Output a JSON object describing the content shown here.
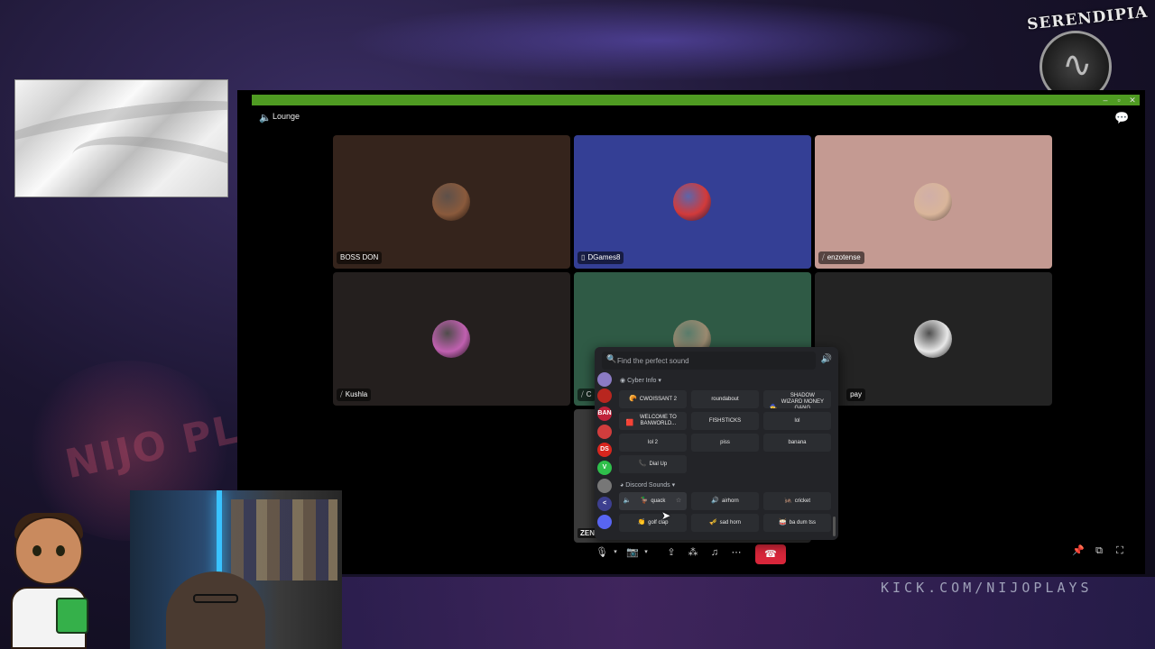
{
  "channel": {
    "name": "Lounge"
  },
  "participants": [
    {
      "name": "BOSS DON",
      "bg": "#35241c",
      "avatar": "#8a5a3c",
      "status_icon": ""
    },
    {
      "name": "DGames8",
      "bg": "#343f95",
      "avatar": "#d23a3a",
      "status_icon": "phone-icon"
    },
    {
      "name": "enzotense",
      "bg": "#c49a92",
      "avatar": "#d9b59a",
      "status_icon": "muted-mic-icon"
    },
    {
      "name": "Kushla",
      "bg": "#241f1e",
      "avatar": "#c060b0",
      "status_icon": "muted-mic-icon"
    },
    {
      "name": "C",
      "bg": "#2f5a45",
      "avatar": "#9a8a70",
      "status_icon": "muted-mic-icon"
    },
    {
      "name": "pay",
      "bg": "#232323",
      "avatar": "#e8e8e8",
      "status_icon": ""
    }
  ],
  "partial_tile_label": "ZEN",
  "soundboard": {
    "search_placeholder": "Find the perfect sound",
    "sections": [
      {
        "title": "Cyber Info",
        "sounds": [
          {
            "label": "CWOISSANT 2",
            "emoji": "🥐"
          },
          {
            "label": "roundabout",
            "emoji": ""
          },
          {
            "label": "SHADOW WIZARD MONEY GANG",
            "emoji": "🧙"
          },
          {
            "label": "WELCOME TO BANWORLD...",
            "emoji": "🟥"
          },
          {
            "label": "FISHSTICKS",
            "emoji": ""
          },
          {
            "label": "lol",
            "emoji": ""
          },
          {
            "label": "lol 2",
            "emoji": ""
          },
          {
            "label": "piss",
            "emoji": ""
          },
          {
            "label": "banana",
            "emoji": ""
          },
          {
            "label": "Dial Up",
            "emoji": "📞"
          }
        ]
      },
      {
        "title": "Discord Sounds",
        "sounds": [
          {
            "label": "quack",
            "emoji": "🦆"
          },
          {
            "label": "airhorn",
            "emoji": "🔊"
          },
          {
            "label": "cricket",
            "emoji": "🦗"
          },
          {
            "label": "golf clap",
            "emoji": "👏"
          },
          {
            "label": "sad horn",
            "emoji": "🎺"
          },
          {
            "label": "ba dum tss",
            "emoji": "🥁"
          }
        ]
      }
    ],
    "guild_icons": [
      {
        "icon": "discord-guild-icon",
        "color": "#8b7bc4",
        "text": ""
      },
      {
        "icon": "red-seal-icon",
        "color": "#b8261f",
        "text": ""
      },
      {
        "icon": "ban-guild-icon",
        "color": "#c0213a",
        "text": "BAN"
      },
      {
        "icon": "red-target-icon",
        "color": "#d13d3d",
        "text": ""
      },
      {
        "icon": "ds-guild-icon",
        "color": "#d8261e",
        "text": "DS"
      },
      {
        "icon": "v-guild-icon",
        "color": "#2fbf4b",
        "text": "V"
      },
      {
        "icon": "gray-guild-icon",
        "color": "#777",
        "text": ""
      },
      {
        "icon": "back-arrow-icon",
        "color": "#3d3f8f",
        "text": "<"
      },
      {
        "icon": "discord-logo-icon",
        "color": "#5865f2",
        "text": ""
      }
    ]
  },
  "overlay": {
    "brand_title": "SERENDIPIA",
    "bg_logo_text": "NIJO PLAYS",
    "kick_url": "KICK.COM/NIJOPLAYS"
  },
  "accent_colors": {
    "titlebar": "#4f9b22",
    "end_call": "#d8263a"
  }
}
